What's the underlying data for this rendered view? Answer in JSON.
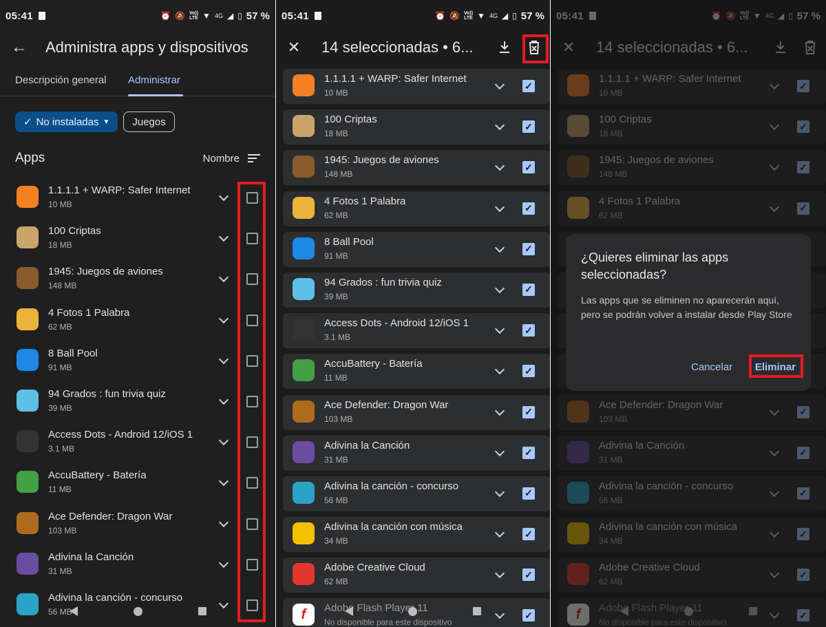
{
  "status_bar": {
    "time": "05:41",
    "battery": "57 %",
    "network": "4G",
    "volte": "Vo))\nLTE"
  },
  "panel1": {
    "title": "Administra apps y dispositivos",
    "tabs": [
      "Descripción general",
      "Administrar"
    ],
    "active_tab": "Administrar",
    "chip_selected": "No instaladas",
    "chip_other": "Juegos",
    "section_label": "Apps",
    "sort_label": "Nombre"
  },
  "panel2": {
    "title": "14 seleccionadas  •  6..."
  },
  "dialog": {
    "title": "¿Quieres eliminar las apps seleccionadas?",
    "body": "Las apps que se eliminen no aparecerán aquí, pero se podrán volver a instalar desde Play Store",
    "cancel": "Cancelar",
    "confirm": "Eliminar"
  },
  "apps": [
    {
      "name": "1.1.1.1 + WARP: Safer Internet",
      "size": "10 MB",
      "icon": "warp-icon",
      "color": "#f48024"
    },
    {
      "name": "100 Criptas",
      "size": "18 MB",
      "icon": "criptas-icon",
      "color": "#c9a46b"
    },
    {
      "name": "1945: Juegos de aviones",
      "size": "148 MB",
      "icon": "planes-icon",
      "color": "#8a5a2b"
    },
    {
      "name": "4 Fotos 1 Palabra",
      "size": "62 MB",
      "icon": "fotos-icon",
      "color": "#e9b33a"
    },
    {
      "name": "8 Ball Pool",
      "size": "91 MB",
      "icon": "ball-icon",
      "color": "#1e88e5"
    },
    {
      "name": "94 Grados : fun trivia quiz",
      "size": "39 MB",
      "icon": "grados-icon",
      "color": "#5dc0e6"
    },
    {
      "name": "Access Dots - Android 12/iOS 1",
      "size": "3.1 MB",
      "icon": "dots-icon",
      "color": "#333333"
    },
    {
      "name": "AccuBattery - Batería",
      "size": "11 MB",
      "icon": "battery-icon",
      "color": "#43a047"
    },
    {
      "name": "Ace Defender: Dragon War",
      "size": "103 MB",
      "icon": "dragon-icon",
      "color": "#b06a1e"
    },
    {
      "name": "Adivina la Canción",
      "size": "31 MB",
      "icon": "cancion-icon",
      "color": "#6a4ca0"
    },
    {
      "name": "Adivina la canción - concurso",
      "size": "56 MB",
      "icon": "concurso-icon",
      "color": "#2aa3c7"
    },
    {
      "name": "Adivina la canción con música",
      "size": "34 MB",
      "icon": "musica-icon",
      "color": "#f2c200"
    },
    {
      "name": "Adobe Creative Cloud",
      "size": "62 MB",
      "icon": "adobe-icon",
      "color": "#e3372f"
    },
    {
      "name": "Adobe Flash Player 11",
      "size": "No disponible para este dispositivo",
      "icon": "flash-icon",
      "color": "#ffffff"
    }
  ],
  "colors": {
    "accent": "#a8c7fa",
    "highlight": "#e51c23",
    "background": "#1f1f1f"
  }
}
